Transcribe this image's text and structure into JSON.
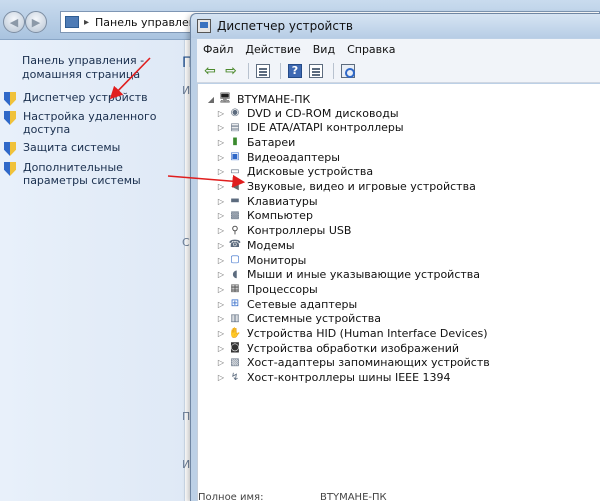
{
  "control_panel": {
    "address": {
      "separator": "▸",
      "crumb": "Панель управления"
    },
    "sidebar": {
      "home_link": "Панель управления - домашняя страница",
      "items": [
        {
          "label": "Диспетчер устройств",
          "icon": "shield-icon"
        },
        {
          "label": "Настройка удаленного доступа",
          "icon": "shield-icon"
        },
        {
          "label": "Защита системы",
          "icon": "shield-icon"
        },
        {
          "label": "Дополнительные параметры системы",
          "icon": "shield-icon"
        }
      ]
    },
    "main_fragments": {
      "heading_start": "П",
      "frag_1": "Из",
      "frag_2": "Си",
      "frag_3": "По",
      "frag_4": "Ин"
    },
    "bottom_partial": "Полное имя:"
  },
  "device_manager": {
    "title": "Диспетчер устройств",
    "menu": [
      "Файл",
      "Действие",
      "Вид",
      "Справка"
    ],
    "toolbar": {
      "back_icon": "back-arrow-icon",
      "forward_icon": "forward-arrow-icon",
      "help_glyph": "?"
    },
    "tree": {
      "root": "BTYMAHE-ПК",
      "categories": [
        {
          "label": "DVD и CD-ROM дисководы",
          "icon": "optical-drive-icon"
        },
        {
          "label": "IDE ATA/ATAPI контроллеры",
          "icon": "ide-controller-icon"
        },
        {
          "label": "Батареи",
          "icon": "battery-icon"
        },
        {
          "label": "Видеоадаптеры",
          "icon": "display-adapter-icon"
        },
        {
          "label": "Дисковые устройства",
          "icon": "disk-drive-icon"
        },
        {
          "label": "Звуковые, видео и игровые устройства",
          "icon": "speaker-icon"
        },
        {
          "label": "Клавиатуры",
          "icon": "keyboard-icon"
        },
        {
          "label": "Компьютер",
          "icon": "computer-icon"
        },
        {
          "label": "Контроллеры USB",
          "icon": "usb-icon"
        },
        {
          "label": "Модемы",
          "icon": "modem-icon"
        },
        {
          "label": "Мониторы",
          "icon": "monitor-icon"
        },
        {
          "label": "Мыши и иные указывающие устройства",
          "icon": "mouse-icon"
        },
        {
          "label": "Процессоры",
          "icon": "processor-icon"
        },
        {
          "label": "Сетевые адаптеры",
          "icon": "network-adapter-icon"
        },
        {
          "label": "Системные устройства",
          "icon": "system-device-icon"
        },
        {
          "label": "Устройства HID (Human Interface Devices)",
          "icon": "hid-icon"
        },
        {
          "label": "Устройства обработки изображений",
          "icon": "camera-icon"
        },
        {
          "label": "Хост-адаптеры запоминающих устройств",
          "icon": "storage-adapter-icon"
        },
        {
          "label": "Хост-контроллеры шины IEEE 1394",
          "icon": "firewire-icon"
        }
      ]
    },
    "bottom_partial": "BTYMAHE-ПК"
  },
  "colors": {
    "accent_arrow": "#e01e1e",
    "title_blue": "#1f4e8c"
  }
}
